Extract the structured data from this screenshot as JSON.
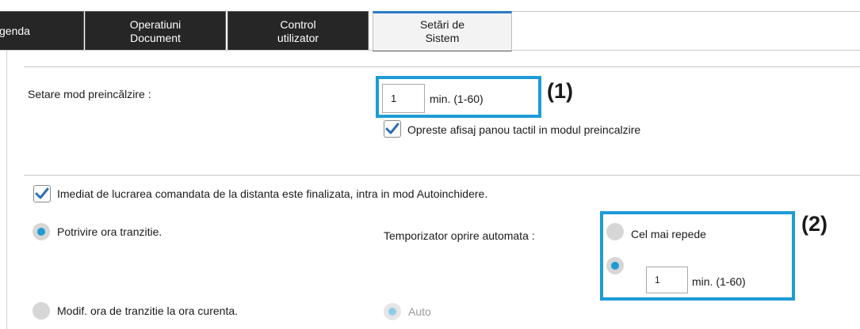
{
  "tabs": [
    {
      "line1": "genda",
      "line2": ""
    },
    {
      "line1": "Operatiuni",
      "line2": "Document"
    },
    {
      "line1": "Control",
      "line2": "utilizator"
    },
    {
      "line1": "Setări de",
      "line2": "Sistem"
    }
  ],
  "preheat": {
    "label": "Setare mod preincălzire :",
    "value": "1",
    "unit": "min. (1-60)",
    "marker": "(1)",
    "touch_panel_off": {
      "checked": true,
      "label": "Opreste afisaj panou tactil in modul preincalzire"
    }
  },
  "remote_job": {
    "checked": true,
    "label": "Imediat de lucrarea comandata de la distanta este finalizata, intra in mod Autoinchidere."
  },
  "transition": {
    "match_label": "Potrivire ora tranzitie.",
    "match_selected": true,
    "modify_label": "Modif. ora de tranzitie la ora curenta.",
    "modify_selected": false
  },
  "auto_power_off": {
    "label": "Temporizator oprire automata :",
    "fastest_label": "Cel mai repede",
    "fastest_selected": false,
    "custom_selected": true,
    "custom_value": "1",
    "custom_unit": "min. (1-60)",
    "marker": "(2)",
    "auto_label": "Auto",
    "auto_selected": true,
    "auto_enabled": false
  },
  "colors": {
    "highlight": "#1e9bd7",
    "radio_on": "#1d9bd3",
    "check": "#2a6fb0",
    "tab_dark": "#262626"
  }
}
